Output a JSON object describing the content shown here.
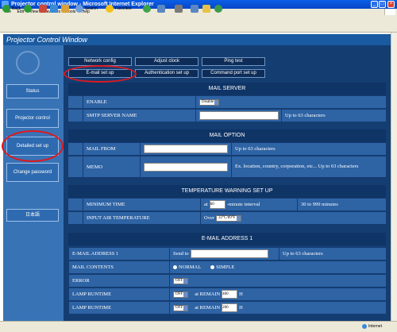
{
  "window": {
    "title": "Projector control window - Microsoft Internet Explorer",
    "min": "_",
    "max": "□",
    "close": "×"
  },
  "menu": [
    "File",
    "Edit",
    "View",
    "Favorites",
    "Tools",
    "Help"
  ],
  "toolbar": {
    "back": "Back",
    "search": "Search",
    "favorites": "Favorites",
    "address_label": "Address",
    "go": "Go"
  },
  "page": {
    "header": "Projector Control Window"
  },
  "sidebar": {
    "status": "Status",
    "projector_control": "Projector control",
    "detailed_setup": "Detailed set up",
    "change_password": "Change password",
    "japanese": "日本語"
  },
  "tabs": {
    "network_config": "Network config",
    "adjust_clock": "Adjust clock",
    "ping_test": "Ping test",
    "email_setup": "E-mail set up",
    "auth_setup": "Authentication set up",
    "command_port": "Command port set up"
  },
  "mail_server": {
    "heading": "MAIL SERVER",
    "enable_label": "ENABLE",
    "enable_value": "Disable",
    "smtp_label": "SMTP SERVER NAME",
    "smtp_note": "Up to 63 characters"
  },
  "mail_option": {
    "heading": "MAIL OPTION",
    "from_label": "MAIL FROM",
    "from_note": "Up to 63 characters",
    "memo_label": "MEMO",
    "memo_note": "Ex. location, country, corporation, etc... Up to 63 characters"
  },
  "temp": {
    "heading": "TEMPERATURE WARNING SET UP",
    "min_time_label": "MINIMUM TIME",
    "at": "at",
    "min_time_value": "60",
    "interval": "-minute interval",
    "min_time_note": "30 to 999 minutes",
    "air_label": "INPUT AIR TEMPERATURE",
    "over": "Over",
    "air_value": "32°C/89°F"
  },
  "email1": {
    "heading": "E-MAIL ADDRESS 1",
    "address_label": "E-MAIL ADDRESS 1",
    "send_to": "Send to",
    "address_note": "Up to 63 characters",
    "contents_label": "MAIL CONTENTS",
    "normal": "NORMAL",
    "simple": "SIMPLE",
    "error_label": "ERROR",
    "error_value": "OFF",
    "lamp1_label": "LAMP RUNTIME",
    "lamp1_value": "OFF",
    "at_remain": "at REMAIN",
    "lamp1_hours": "400",
    "h": "H",
    "lamp2_label": "LAMP RUNTIME",
    "lamp2_value": "OFF",
    "lamp2_hours": "200"
  },
  "status": {
    "right": "Internet"
  }
}
